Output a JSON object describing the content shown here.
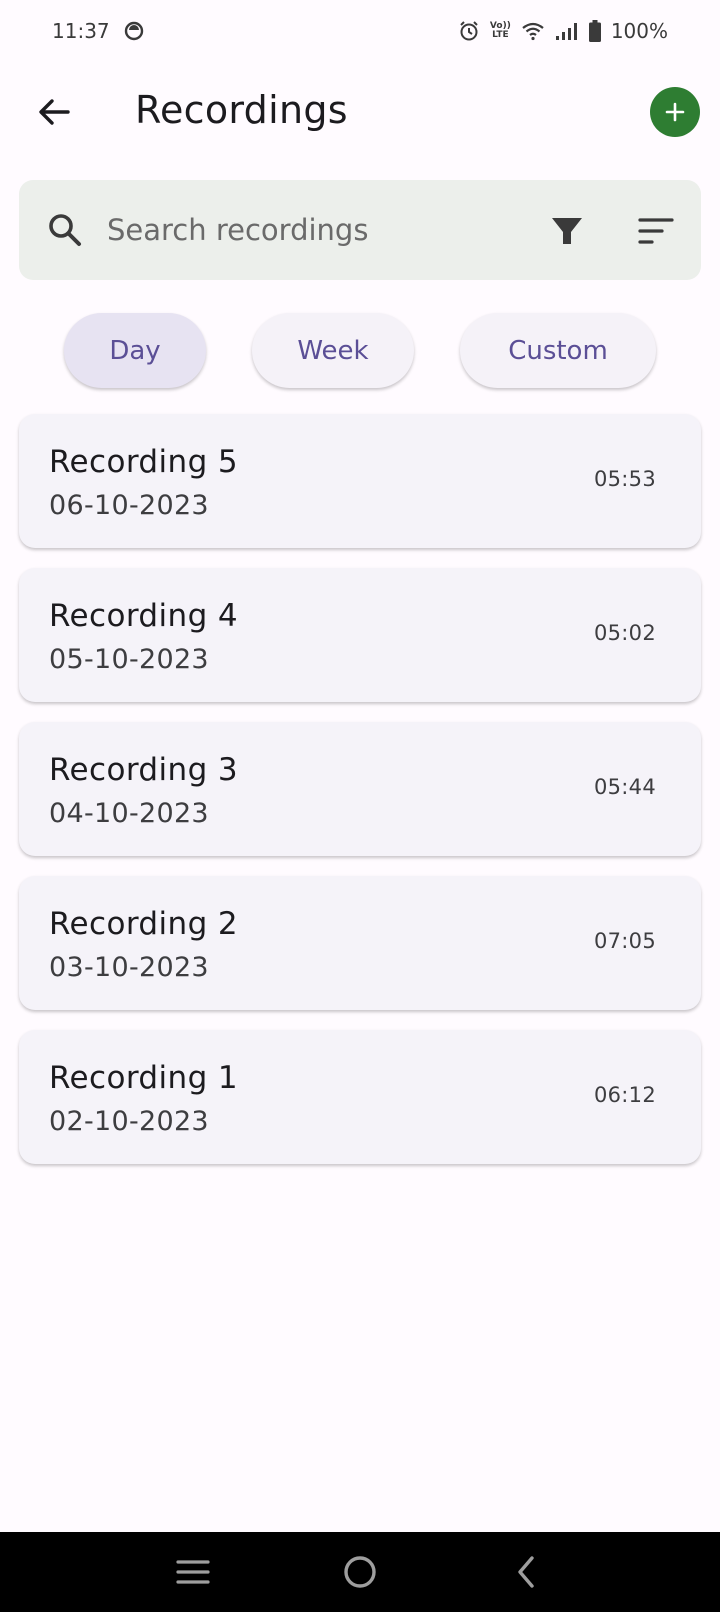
{
  "status_bar": {
    "time": "11:37",
    "battery": "100%",
    "lte_top": "Vo))",
    "lte_bottom": "LTE"
  },
  "app_bar": {
    "title": "Recordings"
  },
  "search": {
    "placeholder": "Search recordings",
    "value": ""
  },
  "filters": {
    "chips": [
      "Day",
      "Week",
      "Custom"
    ],
    "selected": "Day"
  },
  "recordings": [
    {
      "name": "Recording 5",
      "date": "06-10-2023",
      "duration": "05:53"
    },
    {
      "name": "Recording 4",
      "date": "05-10-2023",
      "duration": "05:02"
    },
    {
      "name": "Recording 3",
      "date": "04-10-2023",
      "duration": "05:44"
    },
    {
      "name": "Recording 2",
      "date": "03-10-2023",
      "duration": "07:05"
    },
    {
      "name": "Recording 1",
      "date": "02-10-2023",
      "duration": "06:12"
    }
  ],
  "icons": {
    "back": "arrow-left-icon",
    "add": "plus-icon",
    "search": "search-icon",
    "filter": "filter-icon",
    "sort": "sort-icon",
    "nav_recents": "menu-icon",
    "nav_home": "circle-icon",
    "nav_back": "chevron-left-icon"
  },
  "colors": {
    "accent": "#2e7d32",
    "chip_text": "#5b4f96",
    "search_bg": "#ecefeb",
    "card_bg": "#f5f3f9"
  }
}
